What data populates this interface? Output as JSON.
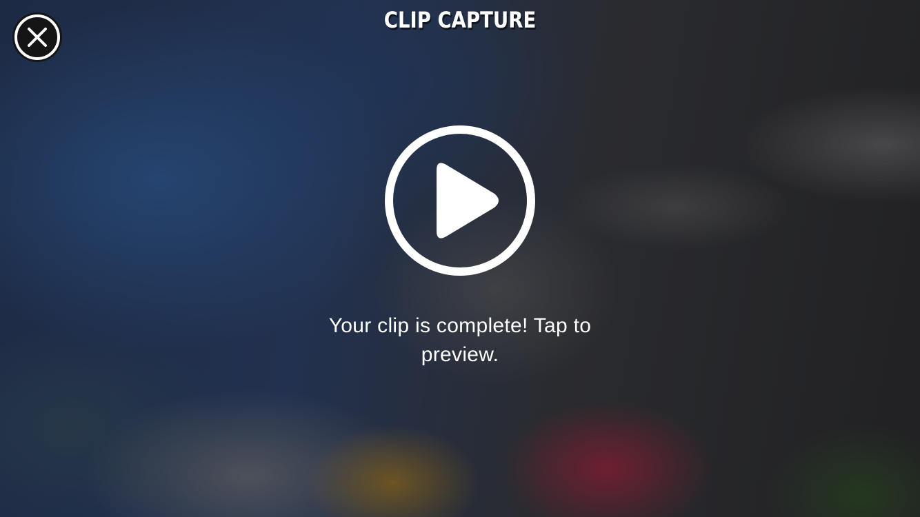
{
  "header": {
    "title": "CLIP CAPTURE"
  },
  "controls": {
    "close_icon": "close-icon",
    "play_icon": "play-icon"
  },
  "main": {
    "message": "Your clip is complete! Tap to preview."
  },
  "colors": {
    "foreground": "#ffffff",
    "close_button_background": "#151515"
  }
}
